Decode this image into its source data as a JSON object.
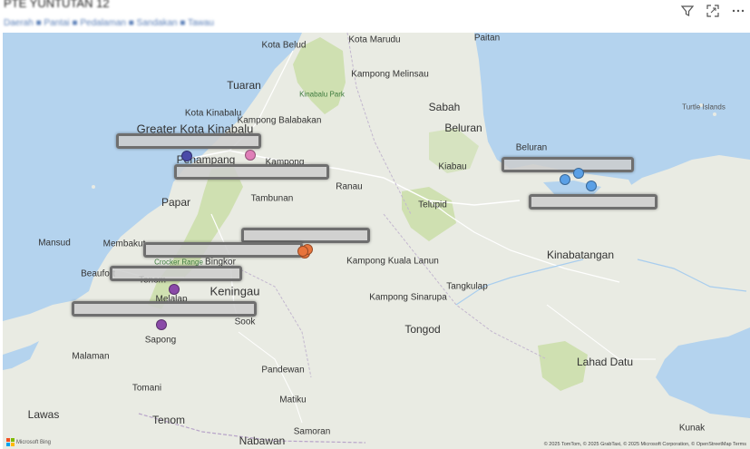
{
  "header": {
    "title": "PTE YUNTUTAN 12",
    "subtitle": "Daerah ■ Pantai ■ Pedalaman ■ Sandakan ■ Tawau"
  },
  "icons": [
    "filter-icon",
    "focus-mode-icon",
    "more-options-icon"
  ],
  "map": {
    "attribution": "© 2025 TomTom, © 2025 GrabTaxi, © 2025 Microsoft Corporation, © OpenStreetMap Terms",
    "provider": "Microsoft Bing",
    "places": [
      {
        "name": "Kota Marudu",
        "size": "normal"
      },
      {
        "name": "Paitan",
        "size": "normal"
      },
      {
        "name": "Kota Belud",
        "size": "normal"
      },
      {
        "name": "Kampong Melinsau",
        "size": "normal"
      },
      {
        "name": "Kinabalu Park",
        "size": "park"
      },
      {
        "name": "Tuaran",
        "size": "big"
      },
      {
        "name": "Kota Kinabalu",
        "size": "normal"
      },
      {
        "name": "Kampong Balabakan",
        "size": "normal"
      },
      {
        "name": "Sabah",
        "size": "big"
      },
      {
        "name": "Beluran",
        "size": "big"
      },
      {
        "name": "Turtle Islands",
        "size": "island"
      },
      {
        "name": "Greater Kota Kinabalu",
        "size": "xl"
      },
      {
        "name": "Penampang",
        "size": "big"
      },
      {
        "name": "Kampong",
        "size": "normal"
      },
      {
        "name": "Beluran",
        "size": "normal"
      },
      {
        "name": "Kiabau",
        "size": "normal"
      },
      {
        "name": "Ranau",
        "size": "normal"
      },
      {
        "name": "Papar",
        "size": "big"
      },
      {
        "name": "Tambunan",
        "size": "normal"
      },
      {
        "name": "Telupid",
        "size": "normal"
      },
      {
        "name": "Mansud",
        "size": "normal"
      },
      {
        "name": "Membakut",
        "size": "normal"
      },
      {
        "name": "Crocker Range",
        "size": "park"
      },
      {
        "name": "Bingkor",
        "size": "normal"
      },
      {
        "name": "Kampong Kuala Lanun",
        "size": "normal"
      },
      {
        "name": "Kinabatangan",
        "size": "big"
      },
      {
        "name": "Beaufort",
        "size": "normal"
      },
      {
        "name": "Tenom",
        "size": "normal"
      },
      {
        "name": "Melalap",
        "size": "normal"
      },
      {
        "name": "Keningau",
        "size": "xl"
      },
      {
        "name": "Kampong Sinarupa",
        "size": "normal"
      },
      {
        "name": "Tangkulap",
        "size": "normal"
      },
      {
        "name": "Sook",
        "size": "normal"
      },
      {
        "name": "Tongod",
        "size": "big"
      },
      {
        "name": "Sapong",
        "size": "normal"
      },
      {
        "name": "Malaman",
        "size": "normal"
      },
      {
        "name": "Pandewan",
        "size": "normal"
      },
      {
        "name": "Lahad Datu",
        "size": "big"
      },
      {
        "name": "Tomani",
        "size": "normal"
      },
      {
        "name": "Matiku",
        "size": "normal"
      },
      {
        "name": "Lawas",
        "size": "big"
      },
      {
        "name": "Tenom",
        "size": "big"
      },
      {
        "name": "Samoran",
        "size": "normal"
      },
      {
        "name": "Kunak",
        "size": "normal"
      },
      {
        "name": "Nabawan",
        "size": "big"
      }
    ],
    "points": [
      {
        "color": "#4a4aa8",
        "label": "navy"
      },
      {
        "color": "#e07fb8",
        "label": "pink"
      },
      {
        "color": "#e8743b",
        "label": "orange-1"
      },
      {
        "color": "#e8743b",
        "label": "orange-2"
      },
      {
        "color": "#e8743b",
        "label": "orange-3"
      },
      {
        "color": "#5aa0e6",
        "label": "blue-1"
      },
      {
        "color": "#5aa0e6",
        "label": "blue-2"
      },
      {
        "color": "#5aa0e6",
        "label": "blue-3"
      },
      {
        "color": "#8a4aa8",
        "label": "purple-1"
      },
      {
        "color": "#8a4aa8",
        "label": "purple-2"
      }
    ]
  }
}
